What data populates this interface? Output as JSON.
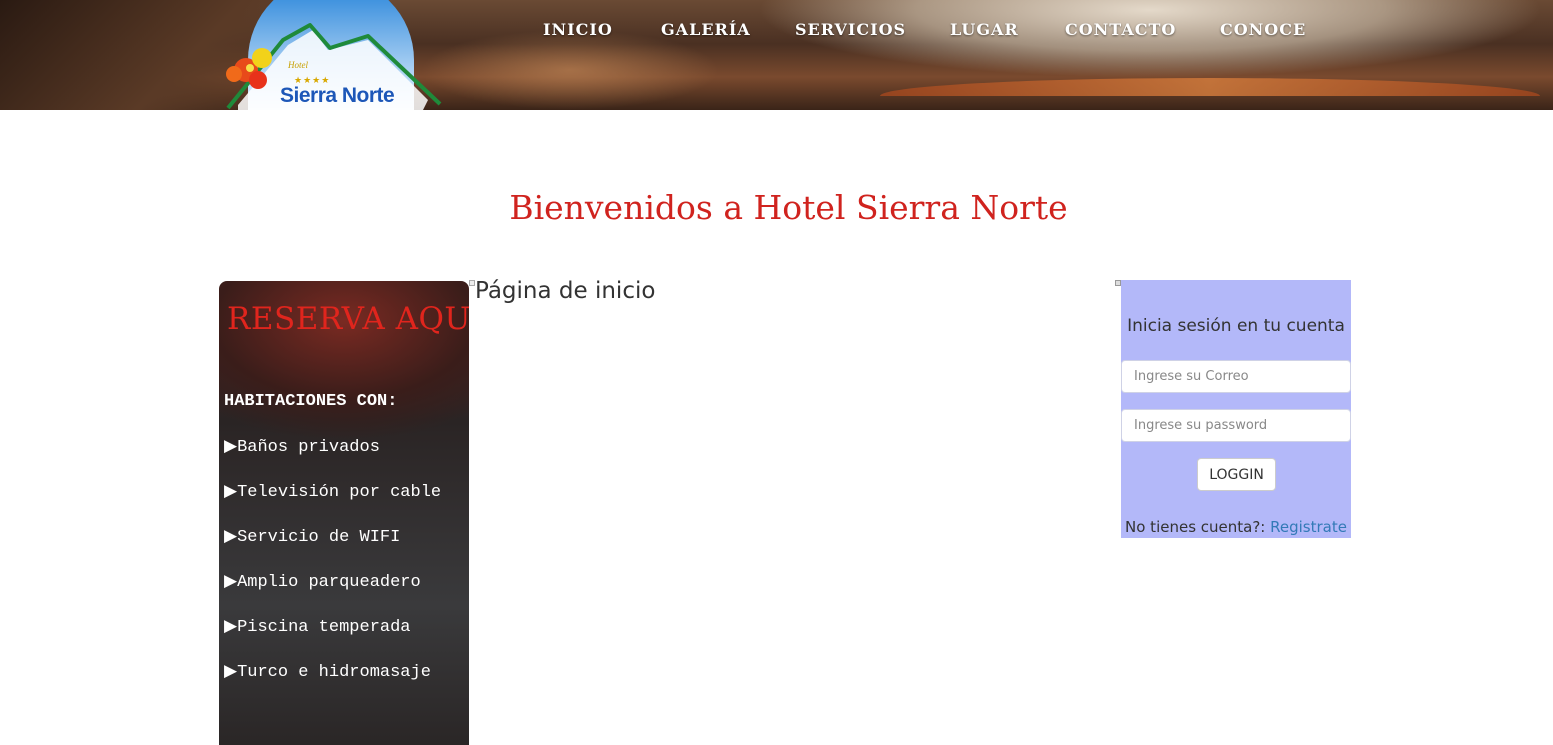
{
  "brand": {
    "logo_text": "Sierra Norte",
    "logo_small": "Hotel",
    "logo_stars": "★★★★"
  },
  "nav": {
    "items": [
      "INICIO",
      "GALERÍA",
      "SERVICIOS",
      "LUGAR",
      "CONTACTO",
      "CONOCE"
    ]
  },
  "welcome": "Bienvenidos a Hotel Sierra Norte",
  "promo": {
    "title": "RESERVA AQUÍ",
    "heading": "HABITACIONES CON:",
    "items": [
      "▶Baños privados",
      "▶Televisión por cable",
      "▶Servicio de WIFI",
      "▶Amplio parqueadero",
      "▶Piscina temperada",
      "▶Turco e hidromasaje"
    ]
  },
  "main": {
    "page_label": "Página de inicio"
  },
  "login": {
    "title": "Inicia sesión en tu cuenta",
    "email_placeholder": "Ingrese su Correo",
    "password_placeholder": "Ingrese su password",
    "button_label": "LOGGIN",
    "footer_text": "No tienes cuenta?: ",
    "register_link": "Registrate"
  },
  "colors": {
    "accent_red": "#d0231e",
    "login_bg": "#b3b8f9",
    "link_blue": "#337ab7"
  }
}
